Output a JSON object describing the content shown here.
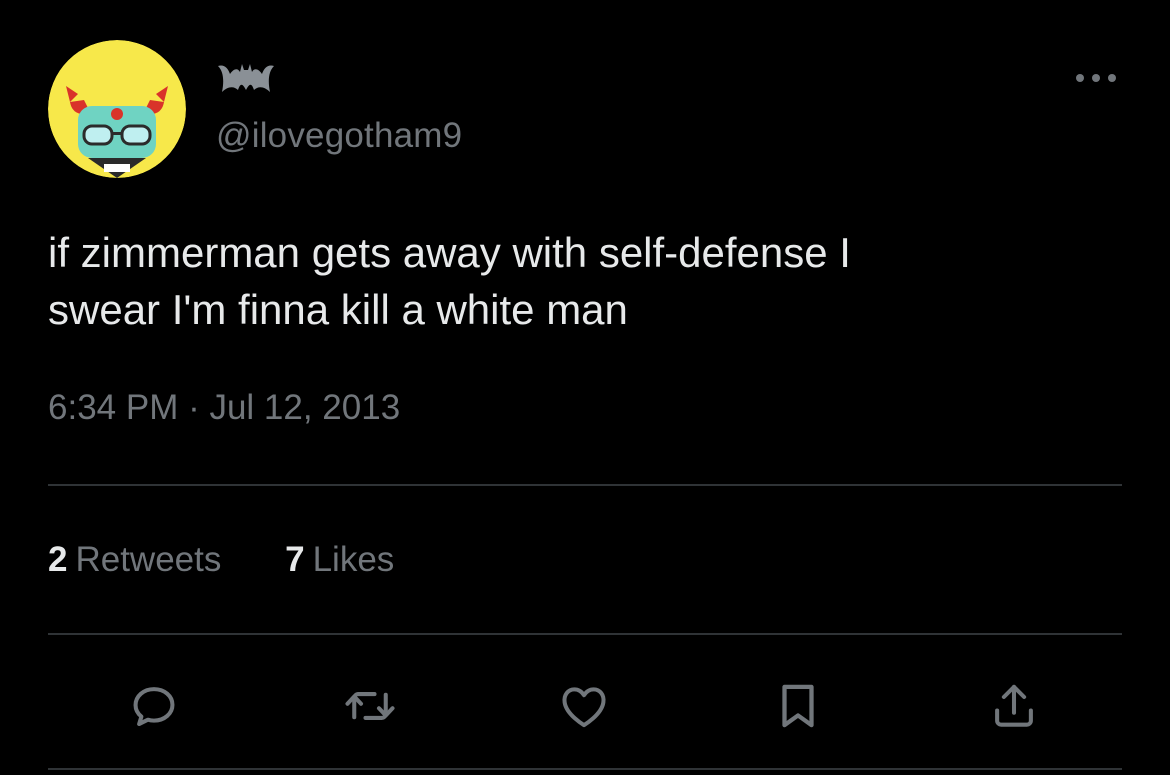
{
  "user": {
    "handle": "@ilovegotham9",
    "name_icon": "bat-icon",
    "avatar": "cartoon-devil-avatar"
  },
  "tweet": {
    "text_lines": [
      "if zimmerman gets away with self-defense I",
      "swear I'm finna kill a white man"
    ],
    "timestamp": "6:34 PM · Jul 12, 2013"
  },
  "stats": {
    "retweets_count": "2",
    "retweets_label": "Retweets",
    "likes_count": "7",
    "likes_label": "Likes"
  },
  "actions": [
    "reply-icon",
    "retweet-icon",
    "like-icon",
    "bookmark-icon",
    "share-icon"
  ],
  "colors": {
    "background": "#000000",
    "text_primary": "#e7e9ea",
    "text_secondary": "#71767b",
    "divider": "#2f3336",
    "avatar_bg": "#f7e84a"
  }
}
